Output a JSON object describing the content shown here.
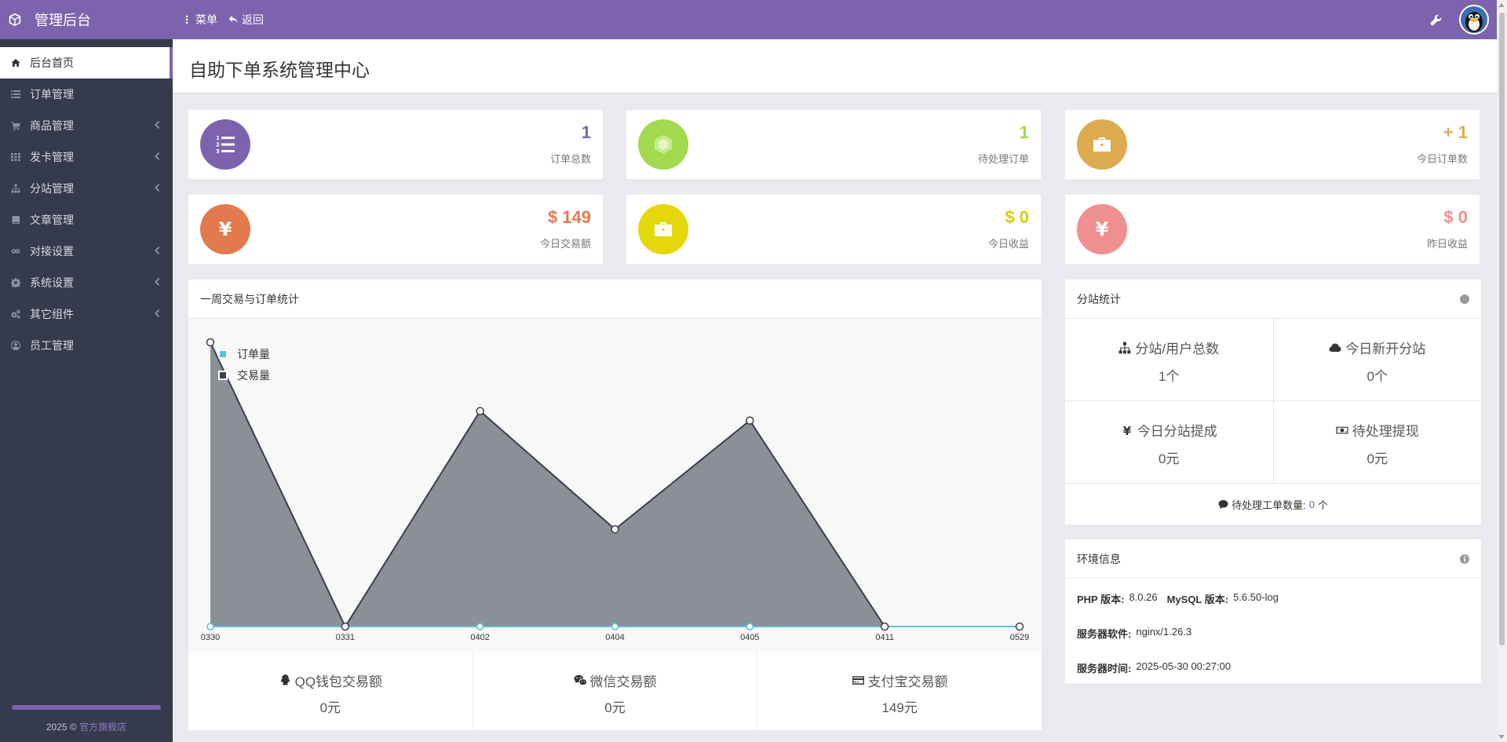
{
  "app": {
    "title": "管理后台"
  },
  "topnav": {
    "menu": "菜单",
    "back": "返回"
  },
  "sidebar": {
    "items": [
      {
        "label": "后台首页",
        "icon": "home-icon",
        "active": true,
        "expandable": false
      },
      {
        "label": "订单管理",
        "icon": "list-icon",
        "active": false,
        "expandable": false
      },
      {
        "label": "商品管理",
        "icon": "cart-icon",
        "active": false,
        "expandable": true
      },
      {
        "label": "发卡管理",
        "icon": "grid-icon",
        "active": false,
        "expandable": true
      },
      {
        "label": "分站管理",
        "icon": "sitemap-icon",
        "active": false,
        "expandable": true
      },
      {
        "label": "文章管理",
        "icon": "book-icon",
        "active": false,
        "expandable": false
      },
      {
        "label": "对接设置",
        "icon": "link-icon",
        "active": false,
        "expandable": true
      },
      {
        "label": "系统设置",
        "icon": "gear-icon",
        "active": false,
        "expandable": true
      },
      {
        "label": "其它组件",
        "icon": "cogs-icon",
        "active": false,
        "expandable": true
      },
      {
        "label": "员工管理",
        "icon": "user-icon",
        "active": false,
        "expandable": false
      }
    ],
    "footer_prefix": "2025 © ",
    "footer_link": "官方旗舰店"
  },
  "page": {
    "title": "自助下单系统管理中心"
  },
  "stats": [
    {
      "value": "1",
      "label": "订单总数",
      "color": "#7d63ad",
      "icon": "ordered-list-icon"
    },
    {
      "value": "1",
      "label": "待处理订单",
      "color": "#a3d84f",
      "icon": "cube-icon"
    },
    {
      "value": "+ 1",
      "label": "今日订单数",
      "color": "#dcab4f",
      "icon": "briefcase-icon"
    },
    {
      "value": "$ 149",
      "label": "今日交易额",
      "color": "#e27a4e",
      "icon": "yen-icon"
    },
    {
      "value": "$ 0",
      "label": "今日收益",
      "color": "#e5d80a",
      "icon": "briefcase-icon"
    },
    {
      "value": "$ 0",
      "label": "昨日收益",
      "color": "#f08f8f",
      "icon": "yen-icon"
    }
  ],
  "weekly_panel": {
    "title": "一周交易与订单统计"
  },
  "chart_data": {
    "type": "area",
    "categories": [
      "0330",
      "0331",
      "0402",
      "0404",
      "0405",
      "0411",
      "0529"
    ],
    "series": [
      {
        "name": "订单量",
        "values": [
          0,
          0,
          0,
          0,
          0,
          0,
          0
        ],
        "color": "#5bc0de"
      },
      {
        "name": "交易量",
        "values": [
          149,
          0,
          113,
          51,
          108,
          0,
          0
        ],
        "color": "#3b3f4c"
      }
    ],
    "ylim": [
      0,
      149
    ],
    "legend": "top-left",
    "grid": false
  },
  "payments": [
    {
      "label": "QQ钱包交易额",
      "value": "0元",
      "icon": "qq-icon"
    },
    {
      "label": "微信交易额",
      "value": "0元",
      "icon": "wechat-icon"
    },
    {
      "label": "支付宝交易额",
      "value": "149元",
      "icon": "credit-card-icon"
    }
  ],
  "substation": {
    "title": "分站统计",
    "cells": [
      {
        "label": "分站/用户总数",
        "value": "1个",
        "icon": "sitemap-icon"
      },
      {
        "label": "今日新开分站",
        "value": "0个",
        "icon": "cloud-icon"
      },
      {
        "label": "今日分站提成",
        "value": "0元",
        "icon": "yen-icon"
      },
      {
        "label": "待处理提现",
        "value": "0元",
        "icon": "money-icon"
      }
    ],
    "ticket_label": "待处理工单数量:",
    "ticket_count": "0",
    "ticket_unit": "个"
  },
  "env": {
    "title": "环境信息",
    "php_label": "PHP 版本:",
    "php_value": "8.0.26",
    "mysql_label": "MySQL 版本:",
    "mysql_value": "5.6.50-log",
    "server_label": "服务器软件:",
    "server_value": "nginx/1.26.3",
    "time_label": "服务器时间:",
    "time_value": "2025-05-30 00:27:00"
  }
}
